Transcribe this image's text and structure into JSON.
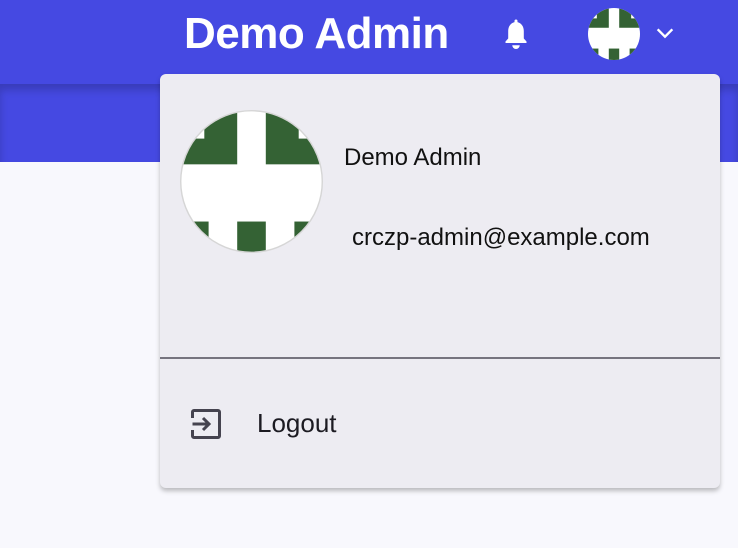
{
  "header": {
    "title": "Demo Admin",
    "notifications_icon": "bell-icon",
    "menu_icon": "chevron-down-icon"
  },
  "user_menu": {
    "name": "Demo Admin",
    "email": "crczp-admin@example.com",
    "logout_label": "Logout",
    "logout_icon": "logout-icon"
  },
  "colors": {
    "primary": "#4549e2",
    "avatar_green": "#346234",
    "menu_bg": "#edecf2"
  }
}
